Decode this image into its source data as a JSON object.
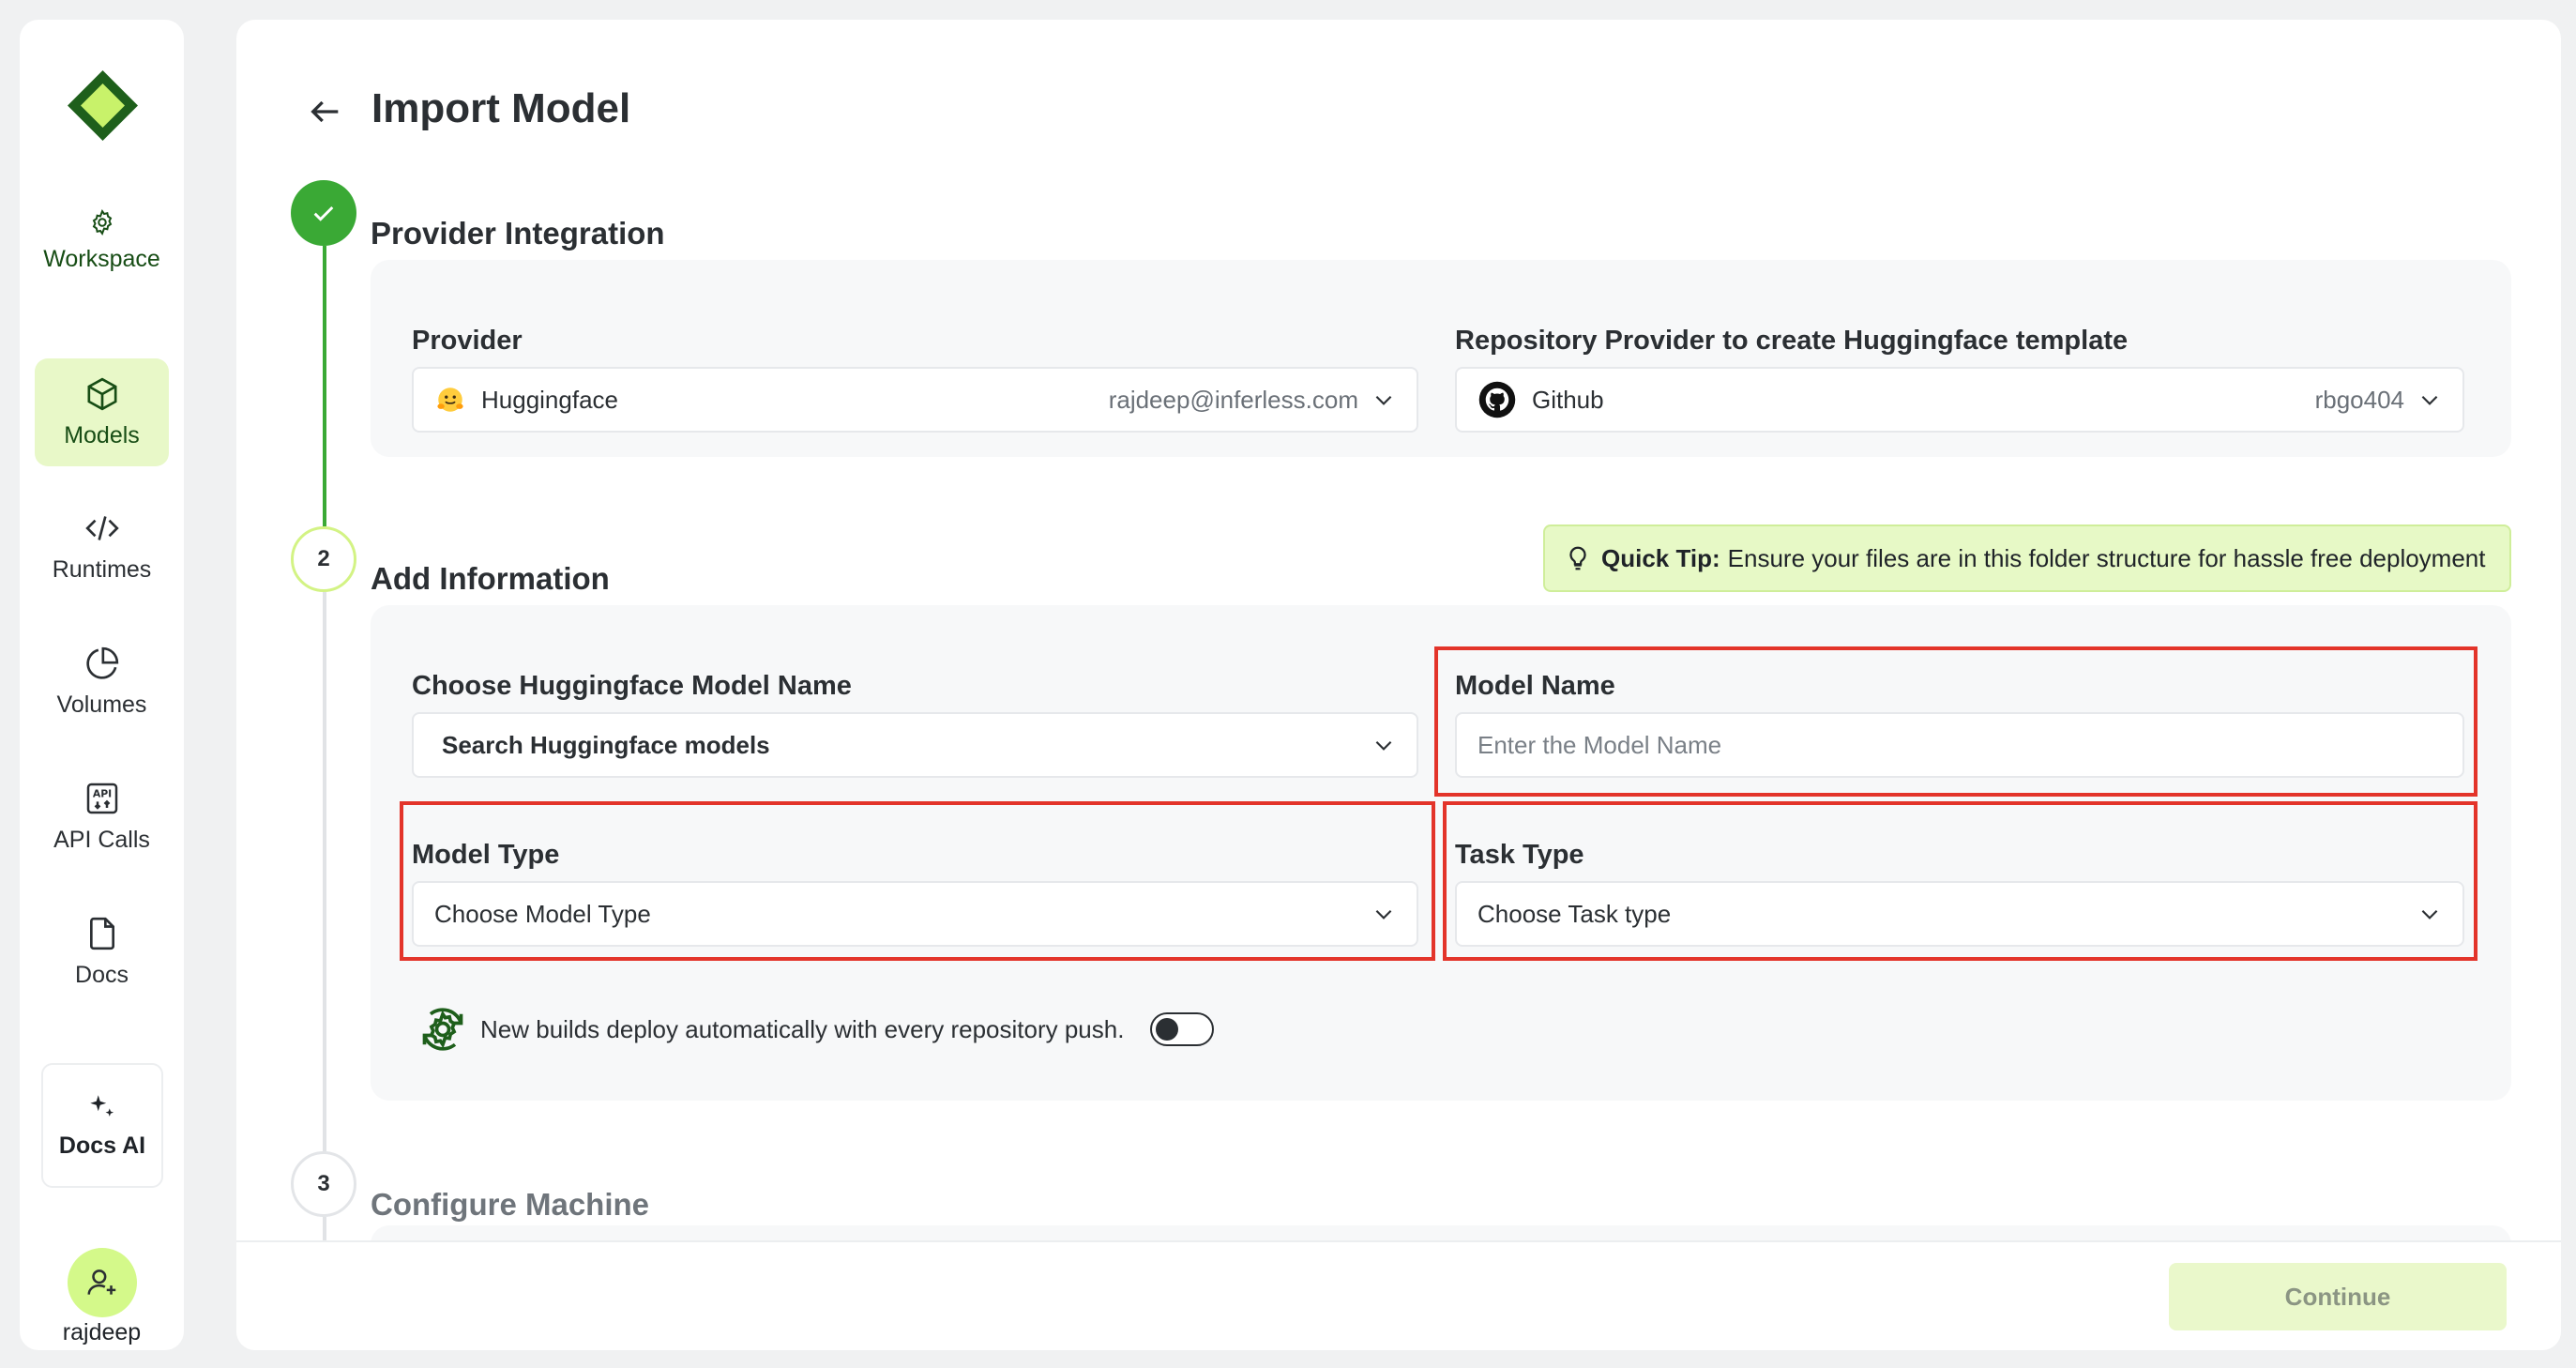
{
  "sidebar": {
    "items": [
      {
        "label": "Workspace",
        "icon": "gear-icon"
      },
      {
        "label": "Models",
        "icon": "cube-icon",
        "active": true
      },
      {
        "label": "Runtimes",
        "icon": "code-icon"
      },
      {
        "label": "Volumes",
        "icon": "pie-chart-icon"
      },
      {
        "label": "API Calls",
        "icon": "api-icon"
      },
      {
        "label": "Docs",
        "icon": "document-icon"
      }
    ],
    "docs_ai": {
      "label": "Docs AI",
      "icon": "sparkle-icon"
    },
    "user": {
      "name": "rajdeep",
      "icon": "user-plus-icon"
    }
  },
  "header": {
    "title": "Import Model"
  },
  "steps": [
    {
      "number": "",
      "title": "Provider Integration",
      "status": "done"
    },
    {
      "number": "2",
      "title": "Add Information",
      "status": "active"
    },
    {
      "number": "3",
      "title": "Configure Machine",
      "status": "pending"
    }
  ],
  "provider": {
    "label": "Provider",
    "value": "Huggingface",
    "account": "rajdeep@inferless.com",
    "icon": "hugging-face-icon"
  },
  "repo_provider": {
    "label": "Repository Provider to create Huggingface template",
    "value": "Github",
    "account": "rbgo404",
    "icon": "github-icon"
  },
  "quick_tip": {
    "title": "Quick Tip:",
    "text": "Ensure your files are in this folder structure for hassle free deployment"
  },
  "hf_model": {
    "label": "Choose Huggingface Model Name",
    "placeholder": "Search Huggingface models"
  },
  "model_name": {
    "label": "Model Name",
    "placeholder": "Enter the Model Name",
    "value": ""
  },
  "model_type": {
    "label": "Model Type",
    "value": "Choose Model Type"
  },
  "task_type": {
    "label": "Task Type",
    "value": "Choose Task type"
  },
  "auto_deploy": {
    "text": "New builds deploy automatically with every repository push.",
    "enabled": false
  },
  "footer": {
    "continue_label": "Continue"
  },
  "colors": {
    "accent_green": "#3aa935",
    "highlight_red": "#e3342a",
    "tip_bg": "#e7f9c6"
  }
}
